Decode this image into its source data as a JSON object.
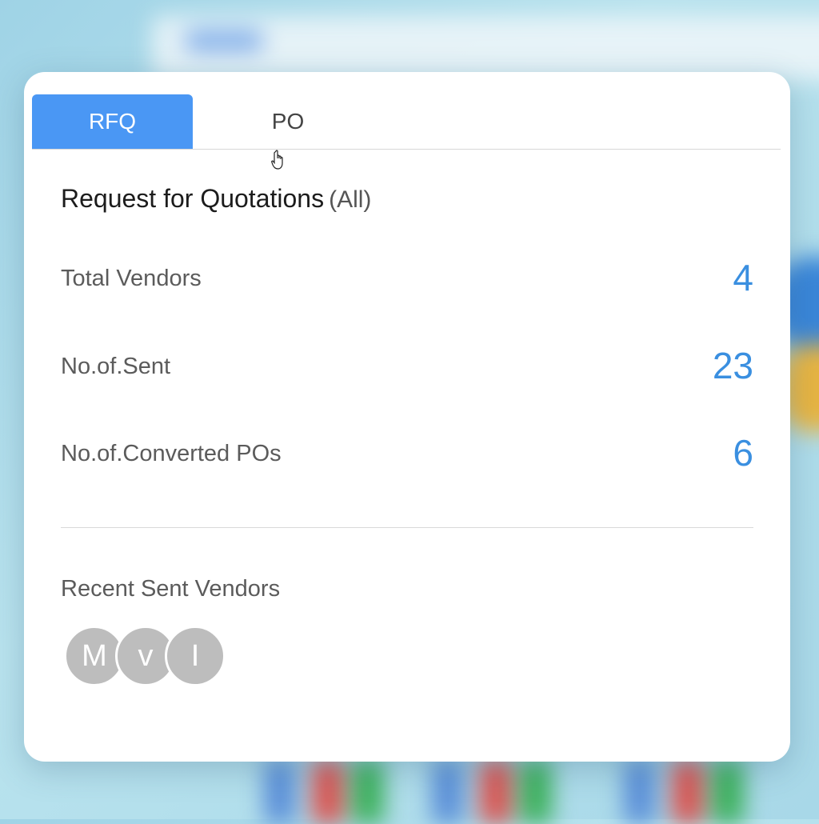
{
  "tabs": [
    {
      "label": "RFQ",
      "active": true
    },
    {
      "label": "PO",
      "active": false
    }
  ],
  "title": "Request for Quotations",
  "title_filter": "(All)",
  "stats": [
    {
      "label": "Total Vendors",
      "value": "4"
    },
    {
      "label": "No.of.Sent",
      "value": "23"
    },
    {
      "label": "No.of.Converted POs",
      "value": "6"
    }
  ],
  "recent_label": "Recent Sent Vendors",
  "recent_vendors": [
    {
      "initial": "M"
    },
    {
      "initial": "v"
    },
    {
      "initial": "I"
    }
  ],
  "colors": {
    "accent": "#4a97f4",
    "value": "#3a8fe0",
    "avatar": "#bdbdbd"
  }
}
